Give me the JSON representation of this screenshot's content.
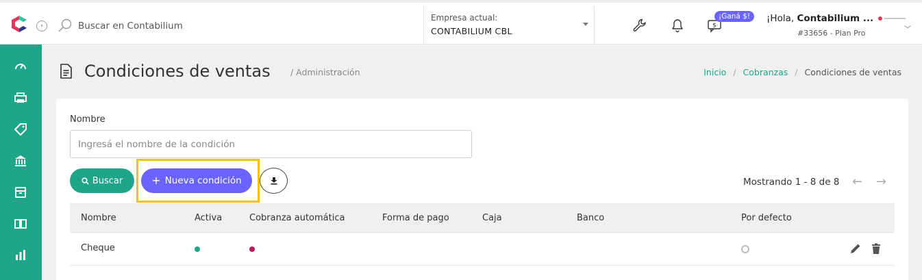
{
  "header": {
    "search_placeholder": "Buscar en Contabilium",
    "company_label": "Empresa actual:",
    "company_value": "CONTABILIUM CBL",
    "promo_badge": "¡Ganá $!",
    "greeting_prefix": "¡Hola,",
    "greeting_name": "Contabilium ...",
    "account": "#33656 - Plan Pro",
    "icons": [
      "wrench-icon",
      "bell-icon",
      "chat-money-icon"
    ]
  },
  "sidebar": {
    "items": [
      "dashboard-icon",
      "printer-icon",
      "tag-icon",
      "bank-icon",
      "box-icon",
      "book-icon",
      "chart-icon"
    ]
  },
  "page": {
    "title": "Condiciones de ventas",
    "subtitle": "/ Administración",
    "breadcrumb": {
      "home": "Inicio",
      "section": "Cobranzas",
      "current": "Condiciones de ventas"
    }
  },
  "filters": {
    "name_label": "Nombre",
    "name_placeholder": "Ingresá el nombre de la condición",
    "search_button": "Buscar",
    "new_button": "Nueva condición"
  },
  "pagination": {
    "text": "Mostrando 1 - 8 de 8"
  },
  "table": {
    "columns": [
      "Nombre",
      "Activa",
      "Cobranza automática",
      "Forma de pago",
      "Caja",
      "Banco",
      "Por defecto"
    ],
    "rows": [
      {
        "nombre": "Cheque",
        "activa": true,
        "cobranza_automatica": false,
        "forma_de_pago": "",
        "caja": "",
        "banco": "",
        "por_defecto": false
      }
    ]
  },
  "colors": {
    "brand": "#1ea58a",
    "accent": "#6c63ff",
    "inactive": "#c0185a",
    "highlight": "#f4c20d"
  }
}
